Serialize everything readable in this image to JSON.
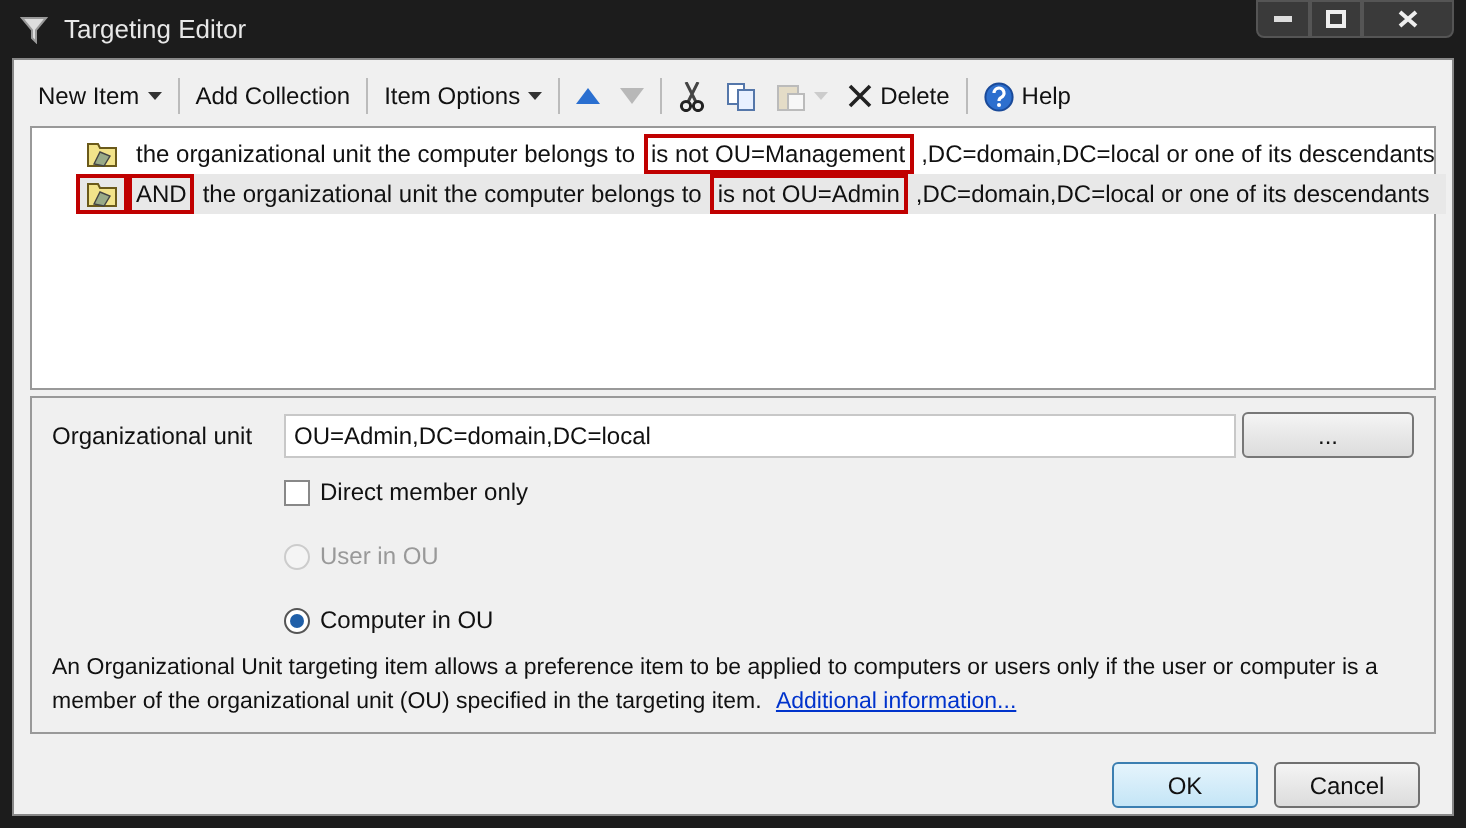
{
  "window": {
    "title": "Targeting Editor"
  },
  "toolbar": [
    [
      {
        "kind": "menu",
        "label": "New Item",
        "disabled": false
      }
    ],
    [
      {
        "kind": "button",
        "label": "Add Collection",
        "disabled": false
      }
    ],
    [
      {
        "kind": "menu",
        "label": "Item Options",
        "disabled": false
      }
    ],
    [
      {
        "kind": "move-up",
        "disabled": false
      },
      {
        "kind": "move-down",
        "disabled": true
      }
    ],
    [
      {
        "kind": "cut",
        "disabled": false
      },
      {
        "kind": "copy",
        "disabled": false
      },
      {
        "kind": "paste",
        "disabled": true
      },
      {
        "kind": "delete",
        "label": "Delete",
        "disabled": false
      }
    ],
    [
      {
        "kind": "help",
        "label": "Help",
        "disabled": false
      }
    ]
  ],
  "items": [
    {
      "selected": false,
      "icon_highlighted": false,
      "segments": [
        {
          "text": "the organizational unit the computer belongs to",
          "highlighted": false
        },
        {
          "text": "is not OU=Management",
          "highlighted": true
        },
        {
          "text": ",DC=domain,DC=local or one of its descendants",
          "highlighted": false
        }
      ]
    },
    {
      "selected": true,
      "icon_highlighted": true,
      "segments": [
        {
          "text": "AND",
          "highlighted": true
        },
        {
          "text": "the organizational unit the computer belongs to",
          "highlighted": false
        },
        {
          "text": "is not OU=Admin",
          "highlighted": true
        },
        {
          "text": ",DC=domain,DC=local or one of its descendants",
          "highlighted": false
        }
      ]
    }
  ],
  "form": {
    "ou_label": "Organizational unit",
    "ou_value": "OU=Admin,DC=domain,DC=local",
    "browse": "...",
    "direct_member": {
      "label": "Direct member only",
      "checked": false
    },
    "options": [
      {
        "label": "User in OU",
        "selected": false,
        "disabled": true
      },
      {
        "label": "Computer in OU",
        "selected": true,
        "disabled": false
      }
    ],
    "description": "An Organizational Unit targeting item allows a preference item to be applied to computers or users only if the user or computer is a member of the organizational unit (OU) specified in the targeting item.",
    "link": "Additional information..."
  },
  "buttons": [
    {
      "label": "OK",
      "default": true
    },
    {
      "label": "Cancel",
      "default": false
    }
  ]
}
